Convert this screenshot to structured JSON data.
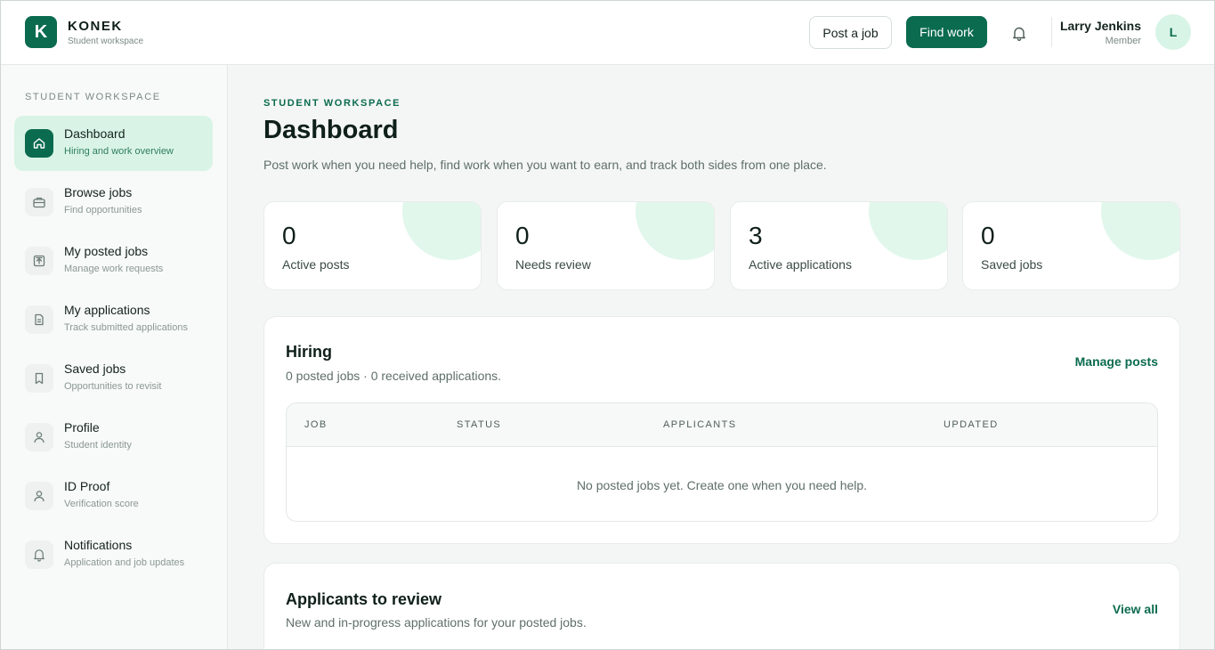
{
  "brand": {
    "initial": "K",
    "name": "KONEK",
    "subtitle": "Student workspace"
  },
  "header": {
    "post_job_label": "Post a job",
    "find_work_label": "Find work",
    "user": {
      "name": "Larry Jenkins",
      "role": "Member",
      "initial": "L"
    }
  },
  "sidebar": {
    "heading": "STUDENT WORKSPACE",
    "items": [
      {
        "label": "Dashboard",
        "sub": "Hiring and work overview",
        "icon": "home-icon",
        "active": true
      },
      {
        "label": "Browse jobs",
        "sub": "Find opportunities",
        "icon": "briefcase-icon"
      },
      {
        "label": "My posted jobs",
        "sub": "Manage work requests",
        "icon": "upload-box-icon"
      },
      {
        "label": "My applications",
        "sub": "Track submitted applications",
        "icon": "document-icon"
      },
      {
        "label": "Saved jobs",
        "sub": "Opportunities to revisit",
        "icon": "bookmark-icon"
      },
      {
        "label": "Profile",
        "sub": "Student identity",
        "icon": "user-icon"
      },
      {
        "label": "ID Proof",
        "sub": "Verification score",
        "icon": "user-icon"
      },
      {
        "label": "Notifications",
        "sub": "Application and job updates",
        "icon": "bell-icon"
      }
    ]
  },
  "main": {
    "eyebrow": "STUDENT WORKSPACE",
    "title": "Dashboard",
    "description": "Post work when you need help, find work when you want to earn, and track both sides from one place.",
    "stats": [
      {
        "value": "0",
        "label": "Active posts"
      },
      {
        "value": "0",
        "label": "Needs review"
      },
      {
        "value": "3",
        "label": "Active applications"
      },
      {
        "value": "0",
        "label": "Saved jobs"
      }
    ],
    "hiring": {
      "title": "Hiring",
      "subtitle": "0 posted jobs · 0 received applications.",
      "link": "Manage posts",
      "columns": [
        "JOB",
        "STATUS",
        "APPLICANTS",
        "UPDATED"
      ],
      "empty_message": "No posted jobs yet. Create one when you need help."
    },
    "applicants": {
      "title": "Applicants to review",
      "subtitle": "New and in-progress applications for your posted jobs.",
      "link": "View all"
    }
  },
  "colors": {
    "brand": "#0b6b4f",
    "accent_light": "#d9f4e6",
    "background": "#f4f6f5"
  }
}
